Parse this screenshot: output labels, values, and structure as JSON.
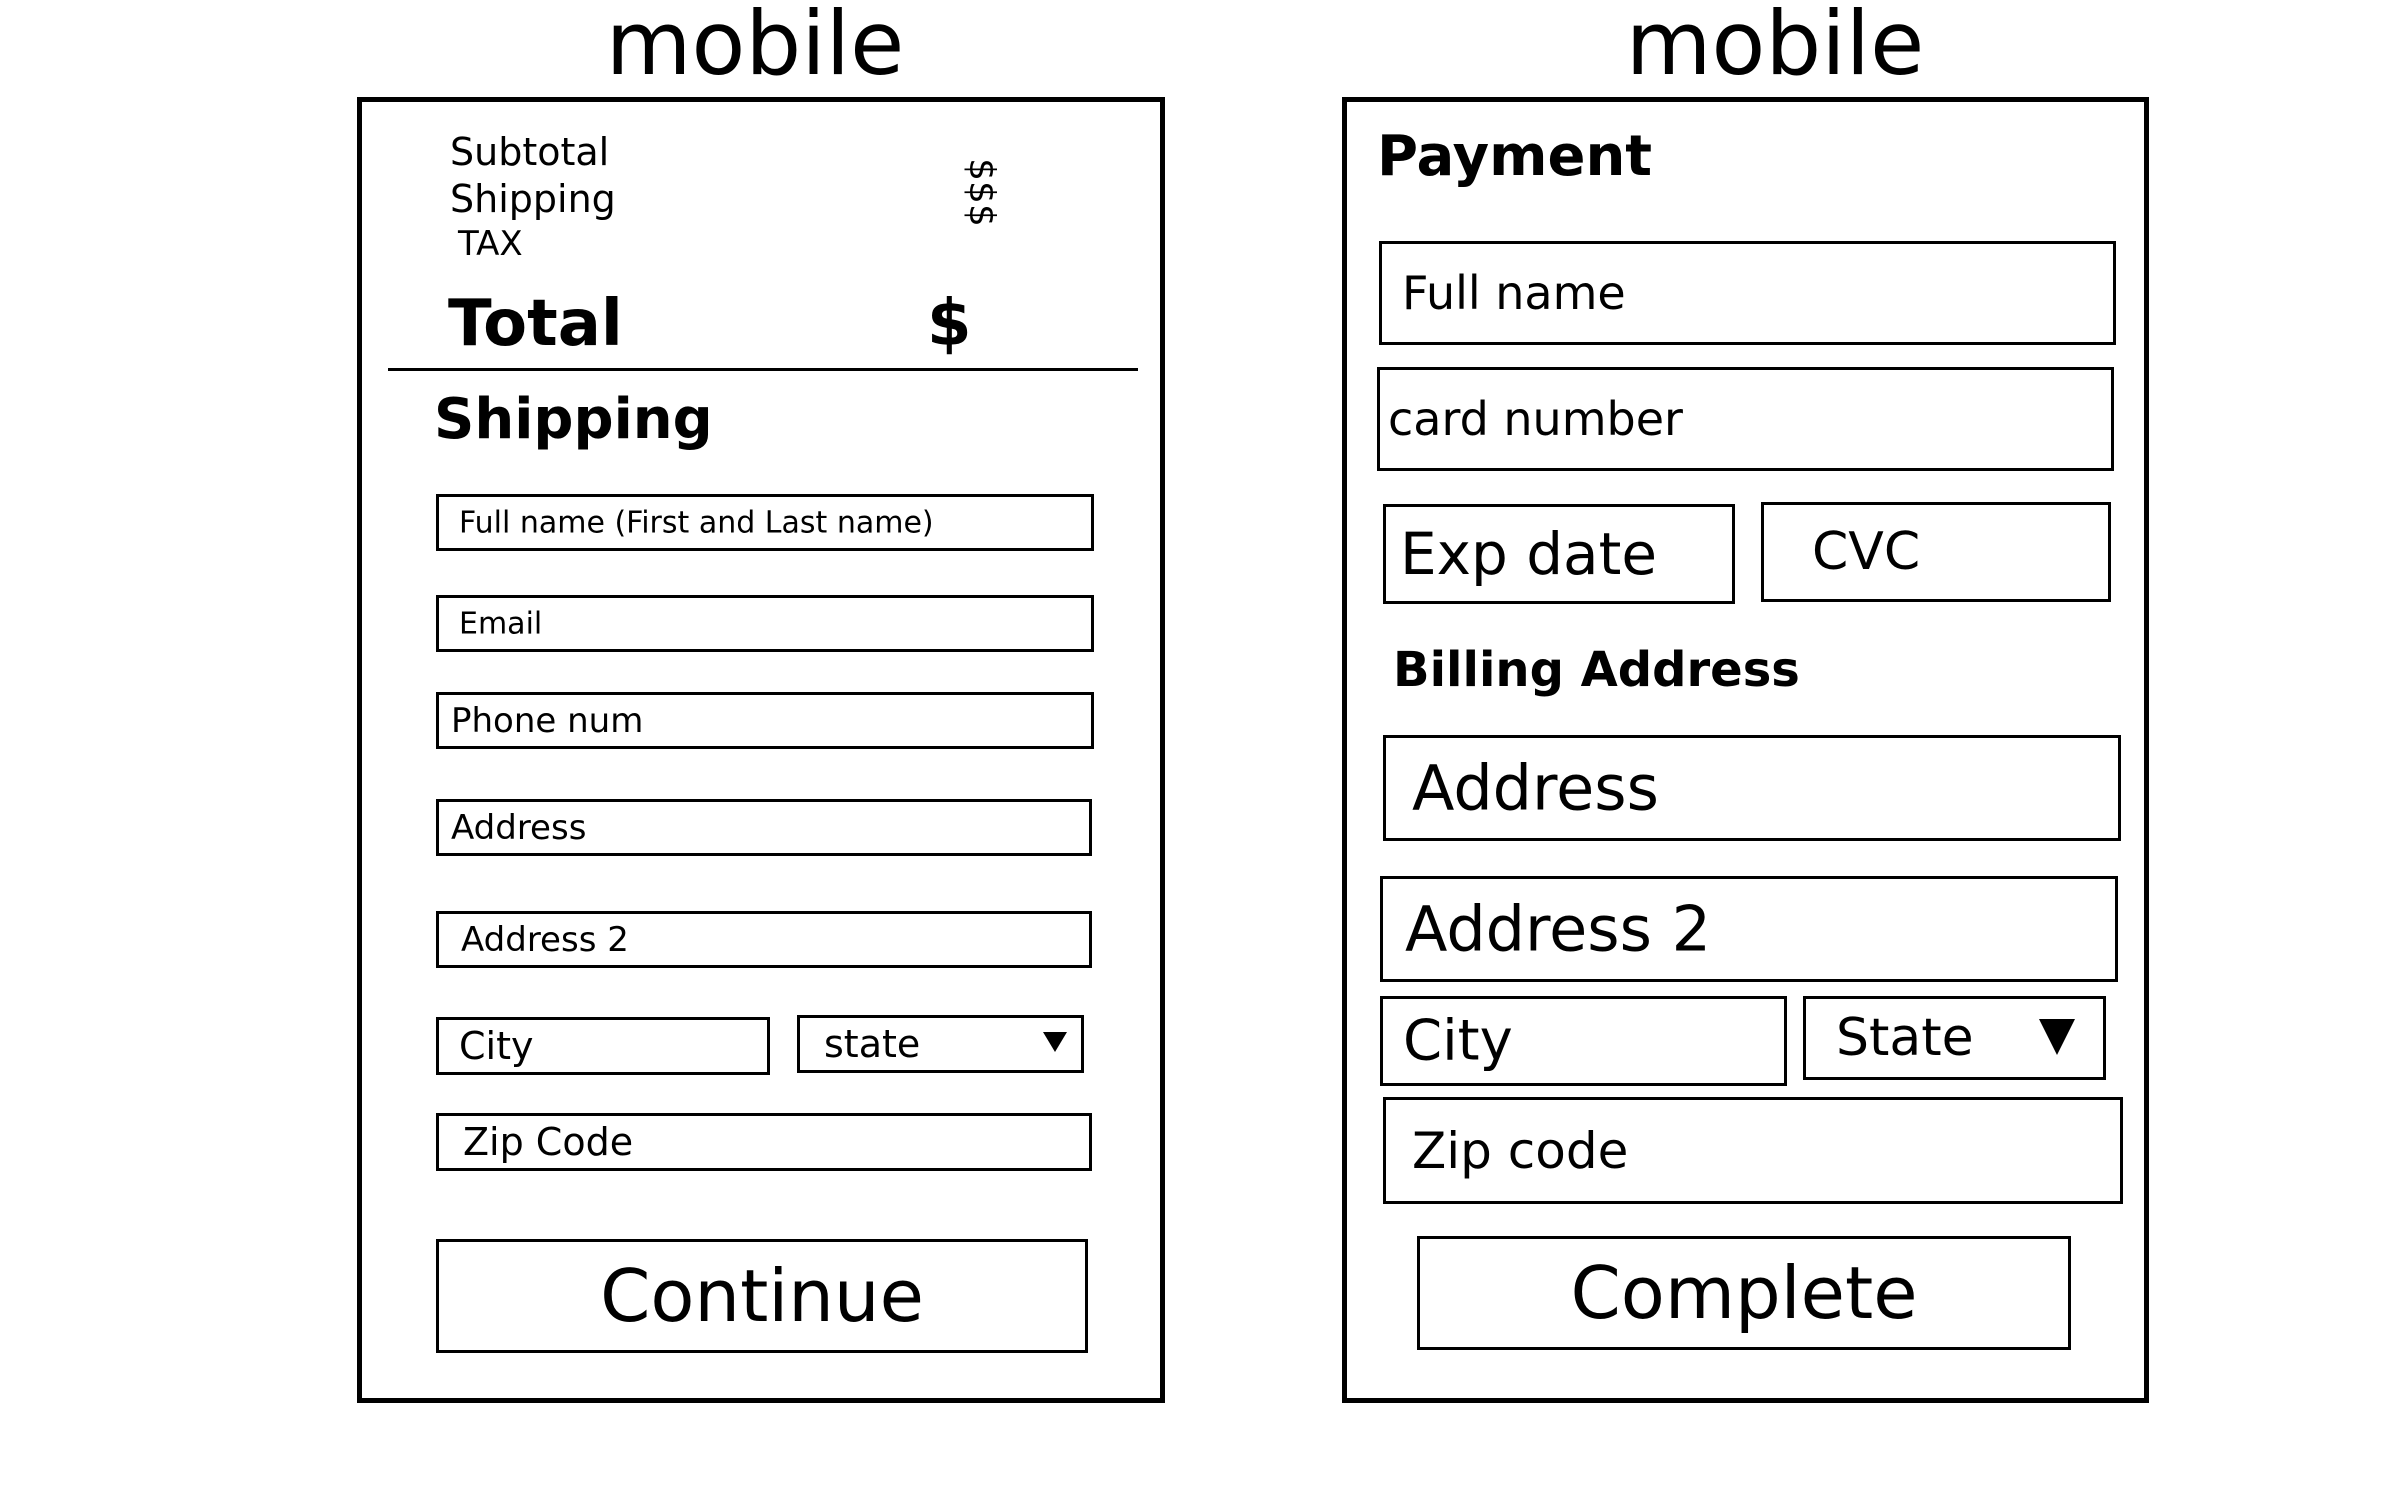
{
  "left_screen": {
    "title": "mobile",
    "summary": {
      "subtotal_label": "Subtotal",
      "shipping_label": "Shipping",
      "tax_label": "TAX",
      "amount_placeholder": "$$$",
      "total_label": "Total",
      "total_value": "$"
    },
    "shipping_heading": "Shipping",
    "fields": {
      "full_name": "Full name (First and Last name)",
      "email": "Email",
      "phone": "Phone num",
      "address": "Address",
      "address2": "Address 2",
      "city": "City",
      "state": "state",
      "zip": "Zip Code"
    },
    "continue_label": "Continue"
  },
  "right_screen": {
    "title": "mobile",
    "payment_heading": "Payment",
    "fields": {
      "full_name": "Full name",
      "card_number": "card number",
      "exp_date": "Exp date",
      "cvc": "CVC",
      "address": "Address",
      "address2": "Address 2",
      "city": "City",
      "state": "State",
      "zip": "Zip code"
    },
    "billing_heading": "Billing Address",
    "complete_label": "Complete"
  }
}
